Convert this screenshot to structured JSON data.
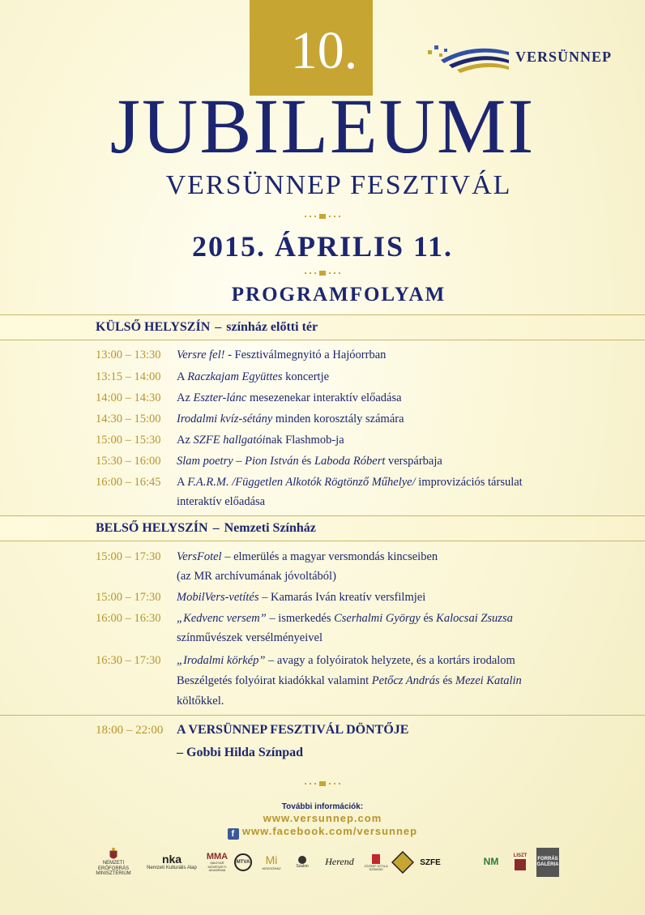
{
  "header": {
    "number": "10.",
    "brand": "VERSÜNNEP",
    "title": "JUBILEUMI",
    "subtitle": "VERSÜNNEP FESZTIVÁL",
    "date": "2015. ÁPRILIS 11.",
    "program_heading": "PROGRAMFOLYAM"
  },
  "colors": {
    "navy": "#1c2670",
    "gold": "#c7a532",
    "time_gold": "#b8942c"
  },
  "sections": [
    {
      "venue": "KÜLSŐ HELYSZÍN",
      "place": "színház előtti tér",
      "items": [
        {
          "time": "13:00 – 13:30",
          "a": "Versre fel!",
          "b": " - Fesztiválmegnyitó a Hajóorrban"
        },
        {
          "time": "13:15 – 14:00",
          "a": "A ",
          "b": "Raczkajam Együttes",
          "c": " koncertje"
        },
        {
          "time": "14:00 – 14:30",
          "a": "Az ",
          "b": "Eszter-lánc",
          "c": " mesezenekar interaktív előadása"
        },
        {
          "time": "14:30 – 15:00",
          "a": "Irodalmi kvíz-sétány",
          "b": " minden korosztály számára"
        },
        {
          "time": "15:00 – 15:30",
          "a": "Az ",
          "b": "SZFE hallgatói",
          "c": "nak Flashmob-ja"
        },
        {
          "time": "15:30 – 16:00",
          "a": "Slam poetry",
          "b": " – ",
          "c": "Pion István",
          "d": " és ",
          "e": "Laboda Róbert",
          "f": " verspárbaja"
        },
        {
          "time": "16:00 – 16:45",
          "a": "A ",
          "b": "F.A.R.M. /Független Alkotók Rögtönző Műhelye/",
          "c": " improvizációs társulat",
          "cont": "interaktív előadása"
        }
      ]
    },
    {
      "venue": "BELSŐ HELYSZÍN",
      "place": "Nemzeti Színház",
      "items": [
        {
          "time": "15:00 – 17:30",
          "a": "VersFotel",
          "b": " – elmerülés a magyar versmondás kincseiben",
          "cont": "(az MR archívumának jóvoltából)"
        },
        {
          "time": "15:00 – 17:30",
          "a": "MobilVers-vetítés",
          "b": " – Kamarás Iván kreatív versfilmjei"
        },
        {
          "time": "16:00 – 16:30",
          "a": "„Kedvenc versem”",
          "b": " – ismerkedés ",
          "c": "Cserhalmi György",
          "d": " és ",
          "e": "Kalocsai Zsuzsa",
          "cont": "színművészek versélményeivel"
        },
        {
          "time": "16:30 – 17:30",
          "a": "„Irodalmi körkép”",
          "b": " – avagy a folyóiratok helyzete, és a kortárs irodalom",
          "cont": "Beszélgetés folyóirat kiadókkal valamint ",
          "cont_a": "Petőcz András",
          "cont_b": " és ",
          "cont_c": "Mezei Katalin",
          "cont2": "költőkkel."
        }
      ]
    }
  ],
  "final": {
    "time": "18:00 – 22:00",
    "title": "A VERSÜNNEP FESZTIVÁL DÖNTŐJE",
    "sub": "– Gobbi Hilda Színpad"
  },
  "info": {
    "label": "További információk:",
    "web": "www.versunnep.com",
    "fb": "www.facebook.com/versunnep"
  },
  "sponsors": [
    {
      "name": "NEMZETI ERŐFORRÁS MINISZTÉRIUM"
    },
    {
      "name": "nka",
      "sub": "Nemzeti Kulturális Alap"
    },
    {
      "name": "MMA",
      "sub": "MAGYAR MŰVÉSZETI AKADÉMIA"
    },
    {
      "name": "MTVA"
    },
    {
      "name": "Mi",
      "sub": "MOZGÓHÁZ"
    },
    {
      "name": "Szalon",
      "sub": "Szalon"
    },
    {
      "name": "Herend"
    },
    {
      "name": "JÓZSEF ATTILA SZÍNHÁZ"
    },
    {
      "name": "SZFE"
    },
    {
      "name": "NM"
    },
    {
      "name": "LISZT"
    },
    {
      "name": "FORRÁS GALÉRIA"
    }
  ]
}
